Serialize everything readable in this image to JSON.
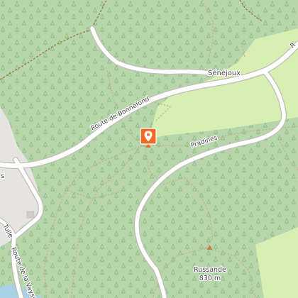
{
  "map": {
    "roads": [
      {
        "label": "Route de Bonnefond",
        "type": "road"
      },
      {
        "label": "Pradines",
        "type": "track"
      },
      {
        "label": "Route de la Vaysse",
        "type": "road"
      },
      {
        "label": "Tulle",
        "type": "road"
      },
      {
        "label": "R",
        "type": "road"
      }
    ],
    "places": [
      {
        "label": "Sénéjoux"
      },
      {
        "label": "s"
      }
    ],
    "peaks": [
      {
        "name": "Russande",
        "elevation": "830 m"
      }
    ],
    "marker": {
      "icon": "location-pin-icon",
      "color": "#f06a25"
    },
    "colors": {
      "forest": "#b7d6ac",
      "meadow": "#d7efb3",
      "road": "#ffffff",
      "road_casing": "#c2bdb4",
      "track": "#c8b08e",
      "boundary": "#9b7d3c",
      "tree_symbol": "#8fbc84",
      "water": "#a9d1e4",
      "urban": "#e6e4e0"
    }
  }
}
